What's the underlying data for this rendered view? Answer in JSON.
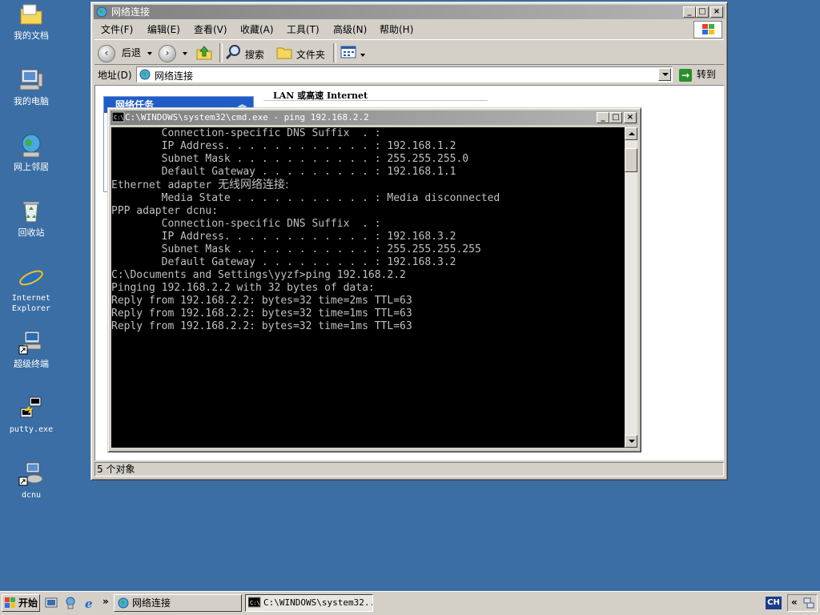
{
  "desktop": {
    "icons": [
      {
        "label": "我的文档"
      },
      {
        "label": "我的电脑"
      },
      {
        "label": "网上邻居"
      },
      {
        "label": "回收站"
      },
      {
        "label": "Internet Explorer"
      },
      {
        "label": "超级终端"
      },
      {
        "label": "putty.exe"
      },
      {
        "label": "dcnu"
      }
    ]
  },
  "explorer": {
    "title": "网络连接",
    "menu": [
      "文件(F)",
      "编辑(E)",
      "查看(V)",
      "收藏(A)",
      "工具(T)",
      "高级(N)",
      "帮助(H)"
    ],
    "toolbar": {
      "back": "后退",
      "search": "搜索",
      "folders": "文件夹"
    },
    "address": {
      "label": "地址(D)",
      "value": "网络连接",
      "go": "转到"
    },
    "taskpane_title": "网络任务",
    "column_header": "LAN 或高速 Internet",
    "status": "5 个对象"
  },
  "cmd": {
    "title": "C:\\WINDOWS\\system32\\cmd.exe - ping 192.168.2.2",
    "lines": [
      "",
      "        Connection-specific DNS Suffix  . :",
      "        IP Address. . . . . . . . . . . . : 192.168.1.2",
      "        Subnet Mask . . . . . . . . . . . : 255.255.255.0",
      "        Default Gateway . . . . . . . . . : 192.168.1.1",
      "",
      "Ethernet adapter ",
      "",
      "        Media State . . . . . . . . . . . : Media disconnected",
      "",
      "PPP adapter dcnu:",
      "",
      "        Connection-specific DNS Suffix  . :",
      "        IP Address. . . . . . . . . . . . : 192.168.3.2",
      "        Subnet Mask . . . . . . . . . . . : 255.255.255.255",
      "        Default Gateway . . . . . . . . . : 192.168.3.2",
      "",
      "C:\\Documents and Settings\\yyzf>ping 192.168.2.2",
      "",
      "Pinging 192.168.2.2 with 32 bytes of data:",
      "",
      "Reply from 192.168.2.2: bytes=32 time=2ms TTL=63",
      "Reply from 192.168.2.2: bytes=32 time=1ms TTL=63",
      "Reply from 192.168.2.2: bytes=32 time=1ms TTL=63"
    ],
    "wireless_name": "无线网络连接:"
  },
  "taskbar": {
    "start": "开始",
    "more": "»",
    "tasks": [
      {
        "label": "网络连接"
      },
      {
        "label": "C:\\WINDOWS\\system32..."
      }
    ],
    "lang": "CH",
    "tray_chevron": "«"
  }
}
